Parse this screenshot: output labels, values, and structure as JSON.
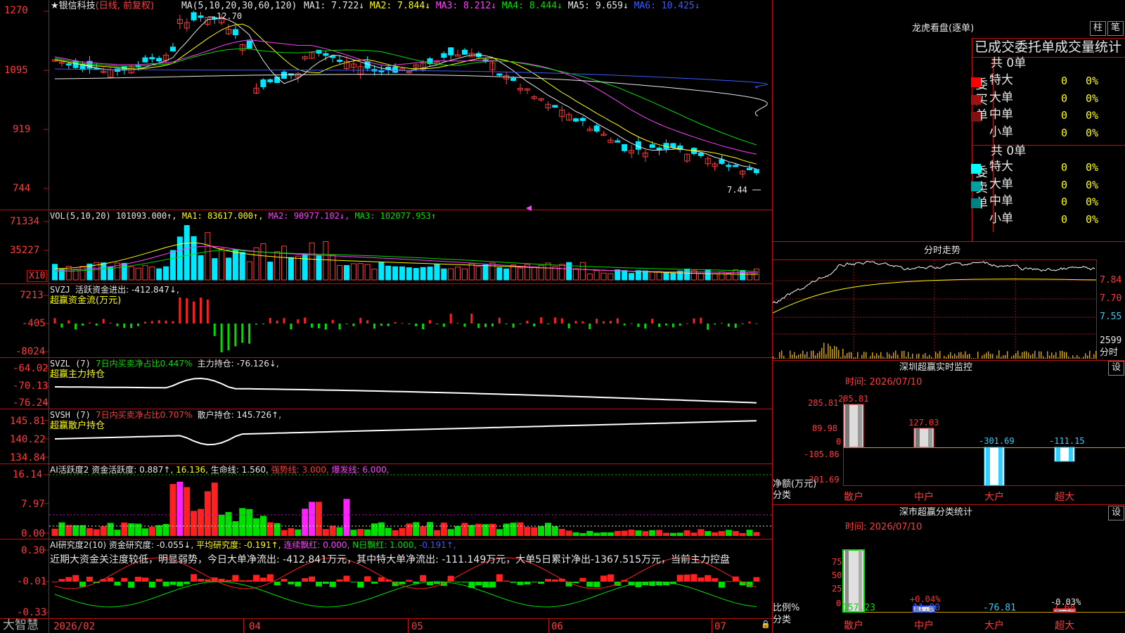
{
  "header": {
    "star": "★",
    "stock_name": "银信科技",
    "period": "(日线, 前复权)",
    "ma_label": "MA(5,10,20,30,60,120)",
    "ma": [
      {
        "text": "MA1: 7.722↓",
        "color": "#e8e8e8"
      },
      {
        "text": "MA2: 7.844↓",
        "color": "#ffff00"
      },
      {
        "text": "MA3: 8.212↓",
        "color": "#ff40ff"
      },
      {
        "text": "MA4: 8.444↓",
        "color": "#00e000"
      },
      {
        "text": "MA5: 9.659↓",
        "color": "#e8e8e8"
      },
      {
        "text": "MA6: 10.425↓",
        "color": "#3a5cff"
      }
    ],
    "max_label": "12.70",
    "min_label": "7.44"
  },
  "price_axis": [
    "1270",
    "1095",
    "919",
    "744"
  ],
  "vol": {
    "title": "VOL(5,10,20)",
    "value": "101093.000↑,",
    "ma1": "MA1: 83617.000↑,",
    "ma2": "MA2: 90977.102↓,",
    "ma3": "MA3: 102077.953↑",
    "axis": [
      "71334",
      "35227"
    ],
    "unit": "X10"
  },
  "svzj": {
    "title": "SVZJ",
    "text": "活跃资金进出: -412.847↓,",
    "subtitle": "超赢资金流(万元)",
    "axis": [
      "7213",
      "-405",
      "-8024"
    ]
  },
  "svzl": {
    "title": "SVZL (7)",
    "t1": "7日内买卖净占比0.447%",
    "t2": "主力持仓: -76.126↓,",
    "subtitle": "超赢主力持仓",
    "axis": [
      "-64.02",
      "-70.13",
      "-76.24"
    ]
  },
  "svsh": {
    "title": "SVSH (7)",
    "t1": "7日内买卖净占比0.707%",
    "t2": "散户持仓: 145.726↑,",
    "subtitle": "超赢散户持仓",
    "axis": [
      "145.81",
      "140.22",
      "134.84"
    ]
  },
  "ai1": {
    "title": "AI活跃度2",
    "t1": "资金活跃度: 0.887↑,",
    "t2": "16.136,",
    "t3": "生命线: 1.560,",
    "t4": "强势线: 3.000,",
    "t5": "爆发线: 6.000,",
    "axis": [
      "16.14",
      "7.97",
      "0.00"
    ]
  },
  "ai2": {
    "title": "AI研究度2(10)",
    "t1": "资金研究度: -0.055↓,",
    "t2": "平均研究度: -0.191↑,",
    "t3": "连续飘红: 0.000,",
    "t4": "N日飘红: 1.000,",
    "t5": "-0.191↑,",
    "comment": "近期大资金关注度较低，明显弱势，今日大单净流出: -412.841万元，其中特大单净流出: -111.149万元，大单5日累计净出-1367.515万元，当前主力控盘",
    "axis": [
      "0.30",
      "-0.01",
      "-0.33"
    ]
  },
  "date_axis": {
    "brand": "大智慧",
    "labels": [
      "2026/02",
      "04",
      "05",
      "06",
      "07"
    ]
  },
  "right": {
    "lhb_title": "龙虎看盘(逐单)",
    "btn_zhu": "柱",
    "btn_bi": "笔",
    "stat_title": "已成交委托单成交量统计",
    "buy": {
      "side_label": "委买单",
      "total": "共 0单",
      "rows": [
        {
          "label": "特大",
          "count": "0",
          "pct": "0%",
          "color": "#ff0000"
        },
        {
          "label": "大单",
          "count": "0",
          "pct": "0%",
          "color": "#a01010"
        },
        {
          "label": "中单",
          "count": "0",
          "pct": "0%",
          "color": "#801010"
        },
        {
          "label": "小单",
          "count": "0",
          "pct": "0%",
          "color": ""
        }
      ]
    },
    "sell": {
      "side_label": "委卖单",
      "total": "共 0单",
      "rows": [
        {
          "label": "特大",
          "count": "0",
          "pct": "0%",
          "color": "#00ffff"
        },
        {
          "label": "大单",
          "count": "0",
          "pct": "0%",
          "color": "#00a0a0"
        },
        {
          "label": "中单",
          "count": "0",
          "pct": "0%",
          "color": "#008080"
        },
        {
          "label": "小单",
          "count": "0",
          "pct": "0%",
          "color": ""
        }
      ]
    },
    "intraday": {
      "title": "分时走势",
      "axis": [
        "7.84",
        "7.70",
        "7.55"
      ],
      "vol_axis": [
        "2599",
        "分时"
      ]
    },
    "sz_monitor": {
      "title": "深圳超赢实时监控",
      "btn": "设",
      "time": "时间: 2026/07/10",
      "axis": [
        "285.81",
        "89.98",
        "0",
        "-105.86",
        "-301.69"
      ],
      "unit_label": "净额(万元)",
      "cat_label": "分类",
      "bars": [
        {
          "label": "散户",
          "value": 285.81,
          "text": "285.81"
        },
        {
          "label": "中户",
          "value": 127.03,
          "text": "127.03"
        },
        {
          "label": "大户",
          "value": -301.69,
          "text": "-301.69"
        },
        {
          "label": "超大",
          "value": -111.15,
          "text": "-111.15"
        }
      ]
    },
    "sh_stats": {
      "title": "深市超赢分类统计",
      "btn": "设",
      "time": "时间: 2026/07/10",
      "axis": [
        "75",
        "50",
        "25",
        "0"
      ],
      "ratio_label": "比例%",
      "cat_label": "分类",
      "bars": [
        {
          "label": "散户",
          "value": "157.23",
          "pct_text": ""
        },
        {
          "label": "中户",
          "value": "11.90",
          "pct_text": "+0.04%"
        },
        {
          "label": "大户",
          "value": "-76.81",
          "pct_text": ""
        },
        {
          "label": "超大",
          "value": "7.68",
          "pct_text": "-0.03%"
        }
      ]
    }
  },
  "colors": {
    "up": "#ff3b3b",
    "down": "#00e8ff",
    "grid": "#b01010"
  }
}
